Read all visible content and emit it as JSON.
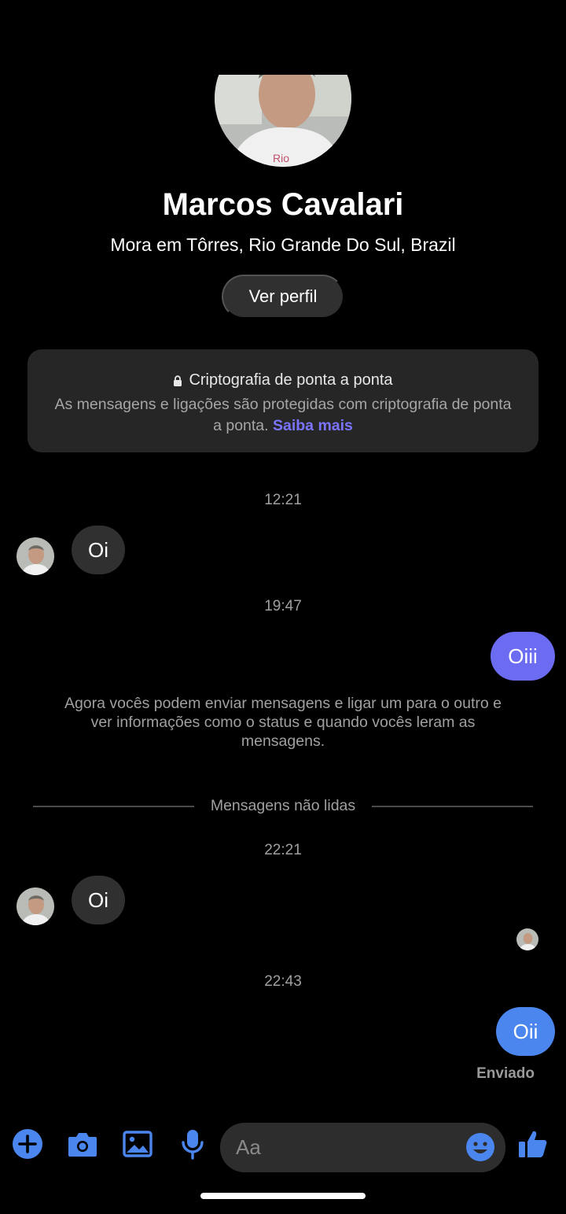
{
  "topbar": {
    "back_icon": "arrow-left-icon",
    "call_icon": "phone-icon",
    "video_icon": "video-camera-icon",
    "info_icon": "info-icon",
    "accent_color": "#a240f5"
  },
  "profile": {
    "name": "Marcos Cavalari",
    "location": "Mora em Tôrres, Rio Grande Do Sul, Brazil",
    "view_profile_label": "Ver perfil"
  },
  "encryption": {
    "title": "Criptografia de ponta a ponta",
    "body": "As mensagens e ligações são protegidas com criptografia de ponta a ponta.",
    "link": "Saiba mais",
    "link_color": "#7b74ff"
  },
  "messages": [
    {
      "time": "12:21",
      "from": "them",
      "text": "Oi"
    },
    {
      "time": "19:47",
      "from": "me",
      "text": "Oiii"
    },
    {
      "time": "22:21",
      "from": "them",
      "text": "Oi"
    },
    {
      "time": "22:43",
      "from": "me",
      "text": "Oii"
    }
  ],
  "system_note": "Agora vocês podem enviar mensagens e ligar um para o outro e ver informações como o status e quando vocês leram as mensagens.",
  "unread_divider": "Mensagens não lidas",
  "sent_status": "Enviado",
  "composer": {
    "placeholder": "Aa",
    "icons": [
      "plus-circle-icon",
      "camera-icon",
      "gallery-icon",
      "microphone-icon",
      "emoji-icon",
      "thumbs-up-icon"
    ],
    "icon_color": "#4a86ee"
  }
}
